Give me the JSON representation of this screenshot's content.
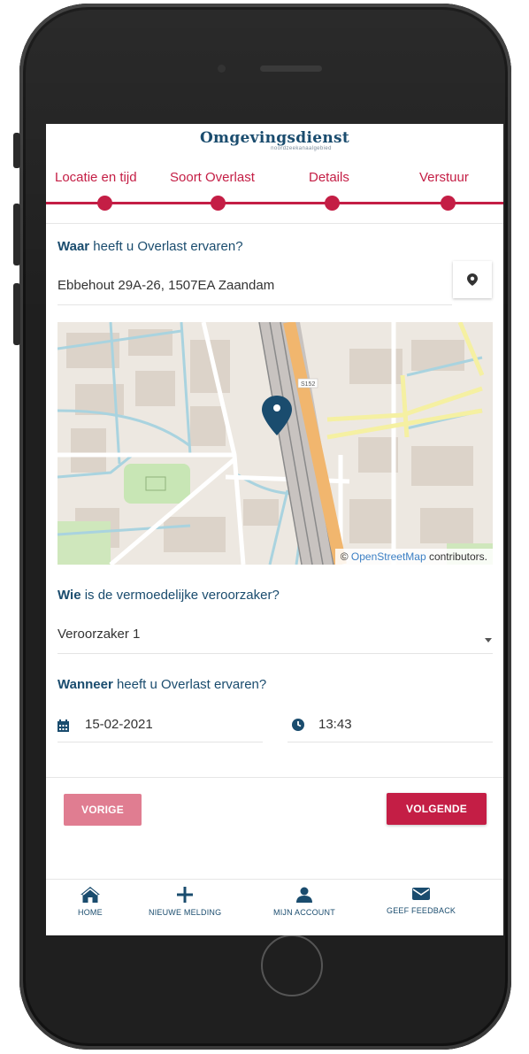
{
  "app": {
    "logo_title": "Omgevingsdienst",
    "logo_subtitle": "noordzeekanaalgebied"
  },
  "steps": [
    {
      "label": "Locatie en tijd"
    },
    {
      "label": "Soort Overlast"
    },
    {
      "label": "Details"
    },
    {
      "label": "Verstuur"
    }
  ],
  "location": {
    "question_strong": "Waar",
    "question_rest": " heeft u Overlast ervaren?",
    "address_value": "Ebbehout 29A-26, 1507EA Zaandam",
    "location_icon": "map-marker-icon"
  },
  "map": {
    "road_label": "S152",
    "attribution_prefix": "© ",
    "attribution_link": "OpenStreetMap",
    "attribution_suffix": " contributors."
  },
  "cause": {
    "question_strong": "Wie",
    "question_rest": " is de vermoedelijke veroorzaker?",
    "selected": "Veroorzaker 1"
  },
  "when": {
    "question_strong": "Wanneer",
    "question_rest": " heeft u Overlast ervaren?",
    "date_value": "15-02-2021",
    "time_value": "13:43"
  },
  "buttons": {
    "previous_label": "VORIGE",
    "next_label": "VOLGENDE"
  },
  "navbar": [
    {
      "label": "HOME",
      "icon": "home-icon"
    },
    {
      "label": "NIEUWE MELDING",
      "icon": "plus-icon"
    },
    {
      "label": "MIJN ACCOUNT",
      "icon": "user-icon"
    },
    {
      "label": "GEEF FEEDBACK",
      "icon": "envelope-icon"
    }
  ],
  "colors": {
    "primary": "#c41e45",
    "primary_light": "#e07d91",
    "brand_blue": "#1a4c6e"
  }
}
